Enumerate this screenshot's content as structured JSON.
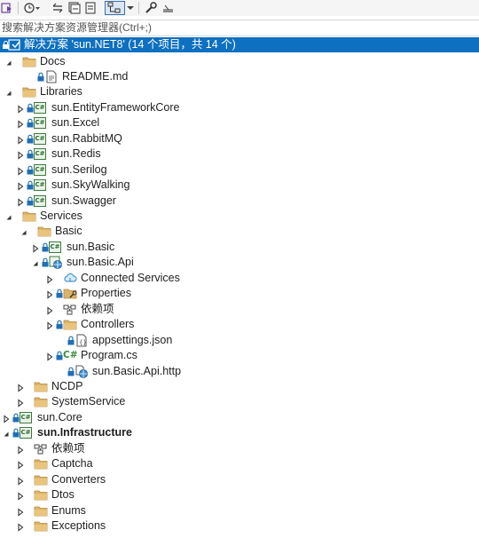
{
  "toolbar": {
    "icons": [
      "solution-explorer-icon",
      "history-icon",
      "sync-icon",
      "collapse-all-icon",
      "show-all-files-icon",
      "view-icon",
      "properties-icon",
      "preview-icon"
    ]
  },
  "search": {
    "placeholder": "搜索解决方案资源管理器(Ctrl+;)"
  },
  "solution": {
    "label": "解决方案 'sun.NET8' (14 个项目，共 14 个)"
  },
  "tree": [
    {
      "label": "Docs"
    },
    {
      "label": "README.md"
    },
    {
      "label": "Libraries"
    },
    {
      "label": "sun.EntityFrameworkCore"
    },
    {
      "label": "sun.Excel"
    },
    {
      "label": "sun.RabbitMQ"
    },
    {
      "label": "sun.Redis"
    },
    {
      "label": "sun.Serilog"
    },
    {
      "label": "sun.SkyWalking"
    },
    {
      "label": "sun.Swagger"
    },
    {
      "label": "Services"
    },
    {
      "label": "Basic"
    },
    {
      "label": "sun.Basic"
    },
    {
      "label": "sun.Basic.Api"
    },
    {
      "label": "Connected Services"
    },
    {
      "label": "Properties"
    },
    {
      "label": "依赖项"
    },
    {
      "label": "Controllers"
    },
    {
      "label": "appsettings.json"
    },
    {
      "label": "Program.cs"
    },
    {
      "label": "sun.Basic.Api.http"
    },
    {
      "label": "NCDP"
    },
    {
      "label": "SystemService"
    },
    {
      "label": "sun.Core"
    },
    {
      "label": "sun.Infrastructure"
    },
    {
      "label": "依赖项"
    },
    {
      "label": "Captcha"
    },
    {
      "label": "Converters"
    },
    {
      "label": "Dtos"
    },
    {
      "label": "Enums"
    },
    {
      "label": "Exceptions"
    }
  ]
}
